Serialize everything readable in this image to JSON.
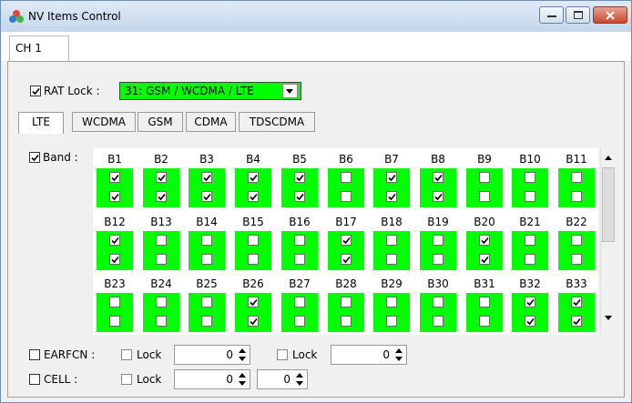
{
  "window": {
    "title": "NV Items Control"
  },
  "tabs": {
    "ch": "CH 1"
  },
  "rat": {
    "label": "RAT Lock :",
    "value": "31: GSM / WCDMA / LTE",
    "checked": true
  },
  "subtabs": [
    "LTE",
    "WCDMA",
    "GSM",
    "CDMA",
    "TDSCDMA"
  ],
  "band": {
    "label": "Band :",
    "checked": true,
    "rows": [
      {
        "names": [
          "B1",
          "B2",
          "B3",
          "B4",
          "B5",
          "B6",
          "B7",
          "B8",
          "B9",
          "B10",
          "B11"
        ],
        "top": [
          1,
          1,
          1,
          1,
          1,
          0,
          1,
          1,
          0,
          0,
          0
        ],
        "bottom": [
          1,
          1,
          1,
          1,
          1,
          0,
          1,
          1,
          0,
          0,
          0
        ]
      },
      {
        "names": [
          "B12",
          "B13",
          "B14",
          "B15",
          "B16",
          "B17",
          "B18",
          "B19",
          "B20",
          "B21",
          "B22"
        ],
        "top": [
          1,
          0,
          0,
          0,
          0,
          1,
          0,
          0,
          1,
          0,
          0
        ],
        "bottom": [
          1,
          0,
          0,
          0,
          0,
          1,
          0,
          0,
          1,
          0,
          0
        ]
      },
      {
        "names": [
          "B23",
          "B24",
          "B25",
          "B26",
          "B27",
          "B28",
          "B29",
          "B30",
          "B31",
          "B32",
          "B33"
        ],
        "top": [
          0,
          0,
          0,
          1,
          0,
          0,
          0,
          0,
          0,
          1,
          1
        ],
        "bottom": [
          0,
          0,
          0,
          1,
          0,
          0,
          0,
          0,
          0,
          1,
          1
        ]
      }
    ]
  },
  "earfcn": {
    "label": "EARFCN :",
    "lock1": "Lock",
    "value1": "0",
    "lock2": "Lock",
    "value2": "0"
  },
  "cell": {
    "label": "CELL :",
    "lock": "Lock",
    "value1": "0",
    "value2": "0"
  },
  "colors": {
    "band_green": "#00ff00",
    "title_bar": "#c5d6ea"
  }
}
